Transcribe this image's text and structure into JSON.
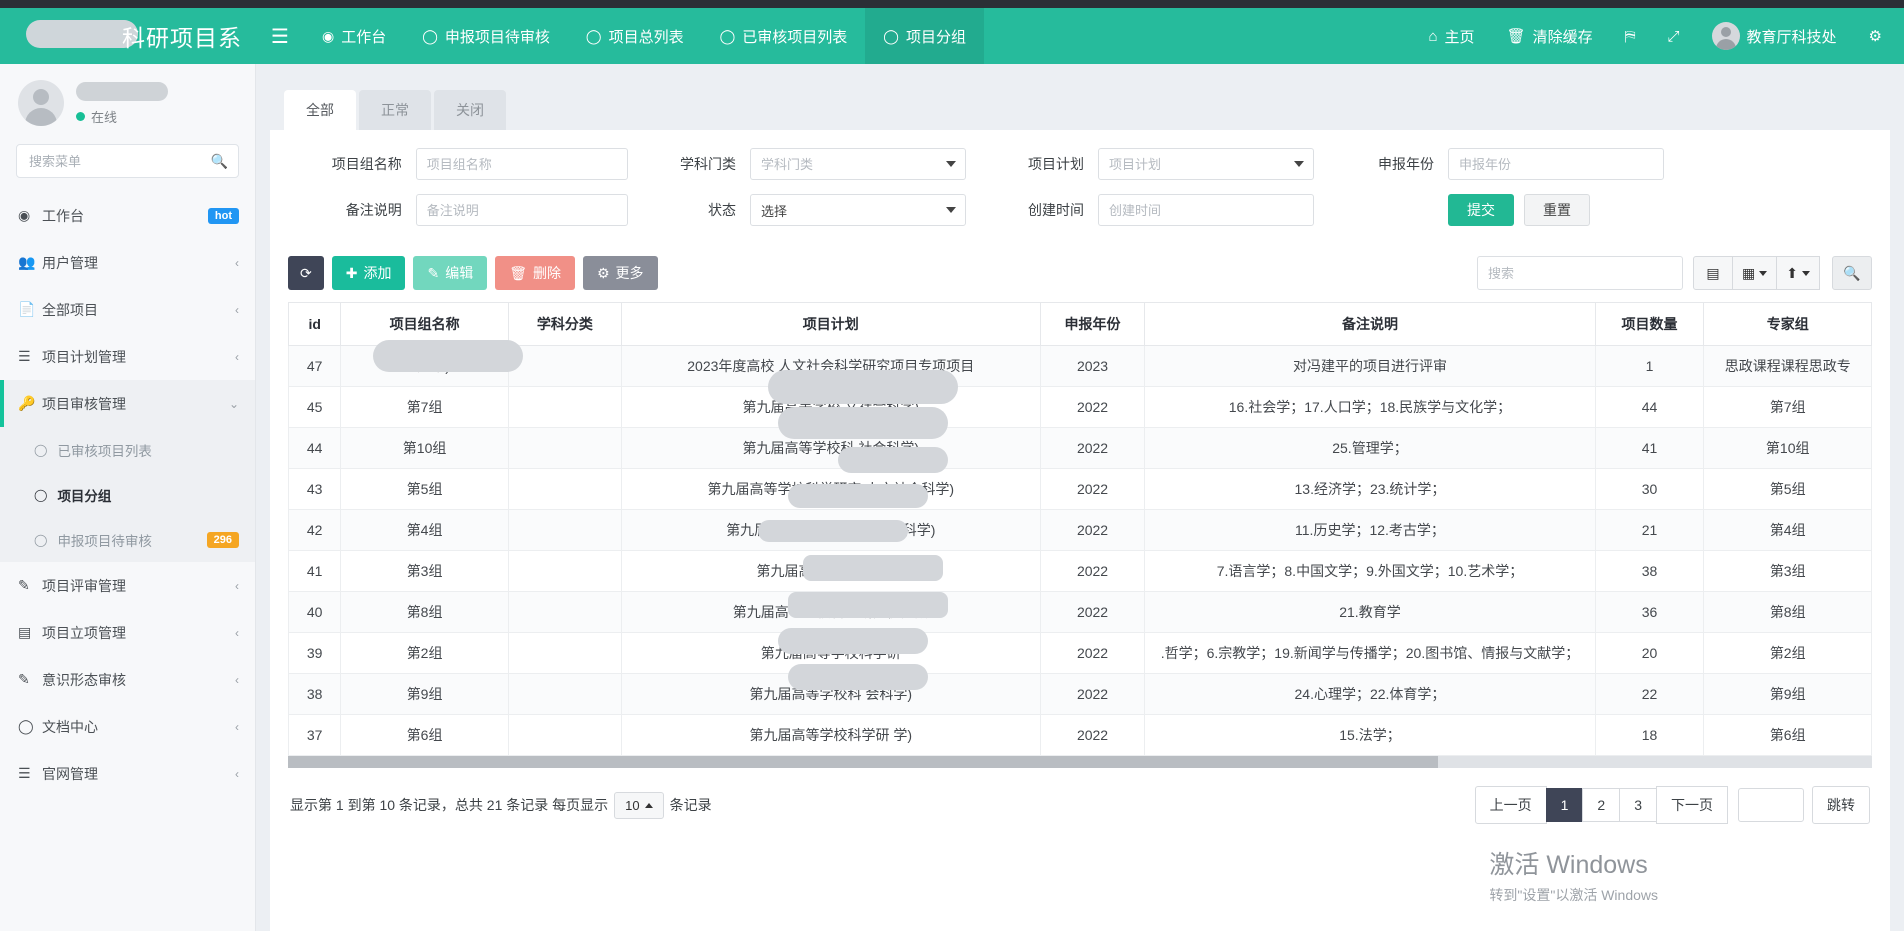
{
  "header": {
    "brand_title": "科研项目系",
    "hamburger_icon": "hamburger-icon",
    "nav": [
      {
        "label": "工作台",
        "icon": "dashboard-icon",
        "active": false
      },
      {
        "label": "申报项目待审核",
        "icon": "circle-icon",
        "active": false
      },
      {
        "label": "项目总列表",
        "icon": "circle-icon",
        "active": false
      },
      {
        "label": "已审核项目列表",
        "icon": "circle-icon",
        "active": false
      },
      {
        "label": "项目分组",
        "icon": "circle-icon",
        "active": true
      }
    ],
    "right": [
      {
        "label": "主页",
        "icon": "home-icon"
      },
      {
        "label": "清除缓存",
        "icon": "trash-icon"
      },
      {
        "label": "",
        "icon": "language-icon"
      },
      {
        "label": "",
        "icon": "fullscreen-icon"
      },
      {
        "label": "教育厅科技处",
        "icon": "avatar-icon"
      },
      {
        "label": "",
        "icon": "settings-gear-icon"
      }
    ]
  },
  "sidebar": {
    "user_status": "在线",
    "search_placeholder": "搜索菜单",
    "search_value": "",
    "search_icon": "search-icon",
    "items": [
      {
        "label": "工作台",
        "icon": "dashboard-icon",
        "badge": "hot",
        "badge_color": "blue",
        "caret": ""
      },
      {
        "label": "用户管理",
        "icon": "users-icon",
        "badge": "",
        "caret": "‹"
      },
      {
        "label": "全部项目",
        "icon": "file-icon",
        "badge": "",
        "caret": "‹"
      },
      {
        "label": "项目计划管理",
        "icon": "list-icon",
        "badge": "",
        "caret": "‹"
      },
      {
        "label": "项目审核管理",
        "icon": "key-icon",
        "badge": "",
        "caret": "⌄",
        "active": true
      }
    ],
    "submenu": [
      {
        "label": "已审核项目列表",
        "badge": "",
        "selected": false
      },
      {
        "label": "项目分组",
        "badge": "",
        "selected": true
      },
      {
        "label": "申报项目待审核",
        "badge": "296",
        "selected": false
      }
    ],
    "items_after": [
      {
        "label": "项目评审管理",
        "icon": "pencil-square-icon",
        "badge": "",
        "caret": "‹"
      },
      {
        "label": "项目立项管理",
        "icon": "database-icon",
        "badge": "",
        "caret": "‹"
      },
      {
        "label": "意识形态审核",
        "icon": "pencil-square-icon",
        "badge": "",
        "caret": "‹"
      },
      {
        "label": "文档中心",
        "icon": "circle-icon",
        "badge": "",
        "caret": "‹"
      },
      {
        "label": "官网管理",
        "icon": "list-icon",
        "badge": "",
        "caret": "‹"
      }
    ]
  },
  "tabs": [
    {
      "label": "全部",
      "active": true
    },
    {
      "label": "正常",
      "active": false
    },
    {
      "label": "关闭",
      "active": false
    }
  ],
  "filters": {
    "row1": [
      {
        "label": "项目组名称",
        "placeholder": "项目组名称",
        "value": "",
        "type": "text"
      },
      {
        "label": "学科门类",
        "placeholder": "学科门类",
        "value": "",
        "type": "select"
      },
      {
        "label": "项目计划",
        "placeholder": "项目计划",
        "value": "",
        "type": "select"
      },
      {
        "label": "申报年份",
        "placeholder": "申报年份",
        "value": "",
        "type": "text"
      }
    ],
    "row2": [
      {
        "label": "备注说明",
        "placeholder": "备注说明",
        "value": "",
        "type": "text"
      },
      {
        "label": "状态",
        "placeholder": "选择",
        "value": "选择",
        "type": "select"
      },
      {
        "label": "创建时间",
        "placeholder": "创建时间",
        "value": "",
        "type": "text"
      }
    ],
    "submit_label": "提交",
    "reset_label": "重置"
  },
  "toolbar": {
    "refresh_icon": "refresh-icon",
    "add_label": "添加",
    "add_icon": "plus-icon",
    "edit_label": "编辑",
    "edit_icon": "pencil-icon",
    "delete_label": "删除",
    "delete_icon": "trash-icon",
    "more_label": "更多",
    "more_icon": "gear-icon",
    "search_placeholder": "搜索",
    "search_value": "",
    "icons": [
      {
        "name": "list-view-icon",
        "glyph": "▤",
        "caret": false
      },
      {
        "name": "columns-icon",
        "glyph": "▦",
        "caret": true
      },
      {
        "name": "export-icon",
        "glyph": "⬆",
        "caret": true
      },
      {
        "name": "search-icon",
        "glyph": "⌕",
        "caret": false
      }
    ]
  },
  "table": {
    "columns": [
      "id",
      "项目组名称",
      "学科分类",
      "项目计划",
      "申报年份",
      "备注说明",
      "项目数量",
      "专家组"
    ],
    "rows": [
      {
        "id": "47",
        "name": "思",
        "name_suffix": "建平)",
        "subject": "",
        "plan": "2023年度高校 人文社会科学研究项目专项项目",
        "year": "2023",
        "remark": "对冯建平的项目进行评审",
        "count": "1",
        "group": "思政课程课程思政专"
      },
      {
        "id": "45",
        "name": "第7组",
        "subject": "",
        "plan": "第九届高等学校",
        "plan_suffix": "文社会科学)",
        "year": "2022",
        "remark": "16.社会学；17.人口学；18.民族学与文化学；",
        "count": "44",
        "group": "第7组"
      },
      {
        "id": "44",
        "name": "第10组",
        "subject": "",
        "plan": "第九届高等学校科",
        "plan_suffix": "社会科学)",
        "year": "2022",
        "remark": "25.管理学；",
        "count": "41",
        "group": "第10组"
      },
      {
        "id": "43",
        "name": "第5组",
        "subject": "",
        "plan": "第九届高等学校科学研究",
        "plan_suffix": "人文社会科学)",
        "year": "2022",
        "remark": "13.经济学；23.统计学；",
        "count": "30",
        "group": "第5组"
      },
      {
        "id": "42",
        "name": "第4组",
        "subject": "",
        "plan": "第九届高等学校科",
        "plan_suffix": "(人文社会科学)",
        "year": "2022",
        "remark": "11.历史学；12.考古学；",
        "count": "21",
        "group": "第4组"
      },
      {
        "id": "41",
        "name": "第3组",
        "subject": "",
        "plan": "第九届高等学",
        "plan_suffix": "社会科学)",
        "year": "2022",
        "remark": "7.语言学；8.中国文学；9.外国文学；10.艺术学；",
        "count": "38",
        "group": "第3组"
      },
      {
        "id": "40",
        "name": "第8组",
        "subject": "",
        "plan": "第九届高等学校科学研究优秀成",
        "plan_suffix": "",
        "year": "2022",
        "remark": "21.教育学",
        "count": "36",
        "group": "第8组"
      },
      {
        "id": "39",
        "name": "第2组",
        "subject": "",
        "plan": "第九届高等学校科学研",
        "plan_suffix": "",
        "year": "2022",
        "remark": ".哲学；6.宗教学；19.新闻学与传播学；20.图书馆、情报与文献学；",
        "count": "20",
        "group": "第2组"
      },
      {
        "id": "38",
        "name": "第9组",
        "subject": "",
        "plan": "第九届高等学校科",
        "plan_suffix": "会科学)",
        "year": "2022",
        "remark": "24.心理学；22.体育学；",
        "count": "22",
        "group": "第9组"
      },
      {
        "id": "37",
        "name": "第6组",
        "subject": "",
        "plan": "第九届高等学校科学研",
        "plan_suffix": "学)",
        "year": "2022",
        "remark": "15.法学；",
        "count": "18",
        "group": "第6组"
      }
    ]
  },
  "footer": {
    "info_text": "显示第 1 到第 10 条记录，总共 21 条记录 每页显示",
    "page_size": "10",
    "info_suffix": "条记录",
    "prev_label": "上一页",
    "pages": [
      "1",
      "2",
      "3"
    ],
    "active_page": "1",
    "next_label": "下一页",
    "jump_label": "跳转",
    "jump_value": ""
  },
  "watermark": {
    "line1": "激活 Windows",
    "line2": "转到\"设置\"以激活 Windows"
  },
  "colors": {
    "brand_teal": "#26bb9c",
    "accent_green": "#1abc9c",
    "badge_blue": "#2196f3",
    "badge_orange": "#f5a623",
    "dark": "#3f4557"
  }
}
